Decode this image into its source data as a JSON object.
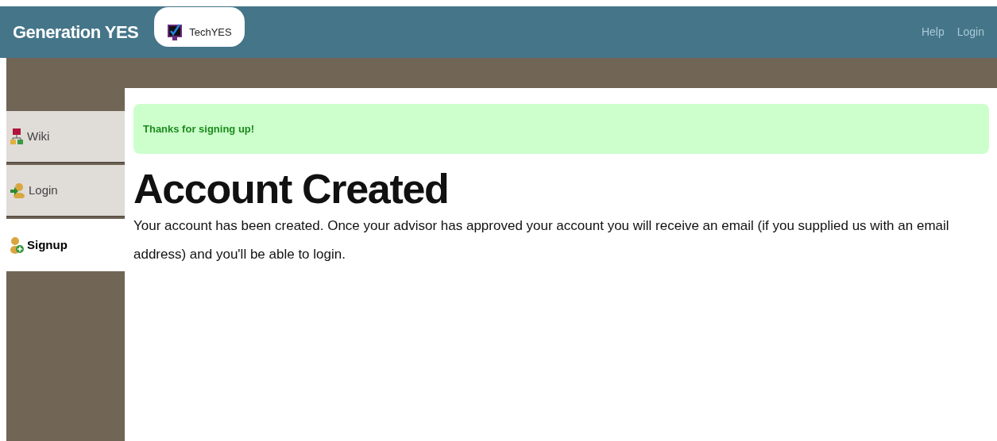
{
  "header": {
    "brand": "Generation YES",
    "app_tab": "TechYES",
    "links": [
      "Help",
      "Login"
    ]
  },
  "sidebar": {
    "items": [
      {
        "label": "Wiki",
        "selected": false
      },
      {
        "label": "Login",
        "selected": false
      },
      {
        "label": "Signup",
        "selected": true
      }
    ]
  },
  "notice": "Thanks for signing up!",
  "title": "Account Created",
  "message": "Your account has been created. Once your advisor has approved your account you will receive an email (if you supplied us with an email address) and you'll be able to login."
}
